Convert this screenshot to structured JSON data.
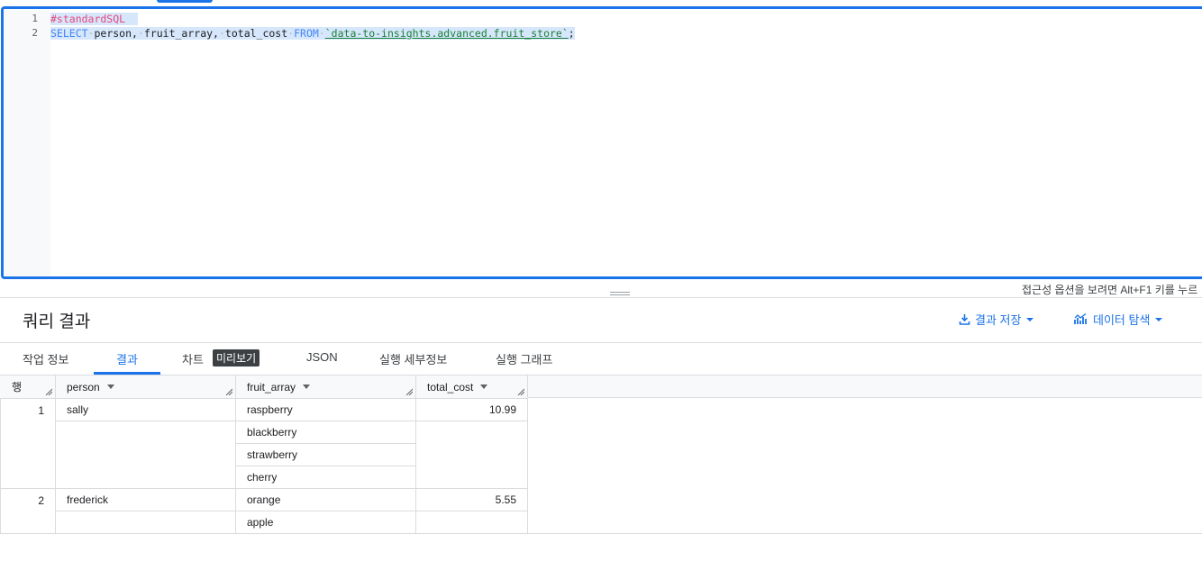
{
  "editor": {
    "lines": [
      {
        "no": "1",
        "comment": "#standardSQL"
      },
      {
        "no": "2",
        "select_kw": "SELECT",
        "col1": "person,",
        "col2": "fruit_array,",
        "col3": "total_cost",
        "from_kw": "FROM",
        "table": "`data-to-insights.advanced.fruit_store`",
        "semi": ";"
      }
    ],
    "accessibility_hint": "접근성 옵션을 보려면 Alt+F1 키를 누르"
  },
  "results": {
    "title": "쿼리 결과",
    "save_label": "결과 저장",
    "explore_label": "데이터 탐색"
  },
  "tabs": [
    {
      "label": "작업 정보"
    },
    {
      "label": "결과"
    },
    {
      "label": "차트"
    },
    {
      "label": "JSON"
    },
    {
      "label": "실행 세부정보"
    },
    {
      "label": "실행 그래프"
    }
  ],
  "preview_badge": "미리보기",
  "table": {
    "headers": {
      "row": "행",
      "person": "person",
      "fruit_array": "fruit_array",
      "total_cost": "total_cost"
    },
    "rows": [
      {
        "row": "1",
        "person": "sally",
        "fruits": [
          "raspberry",
          "blackberry",
          "strawberry",
          "cherry"
        ],
        "total_cost": "10.99"
      },
      {
        "row": "2",
        "person": "frederick",
        "fruits": [
          "orange",
          "apple"
        ],
        "total_cost": "5.55"
      }
    ]
  },
  "colors": {
    "accent": "#1a73e8",
    "comment": "#e8467c",
    "keyword": "#4285f4",
    "string": "#188038"
  }
}
